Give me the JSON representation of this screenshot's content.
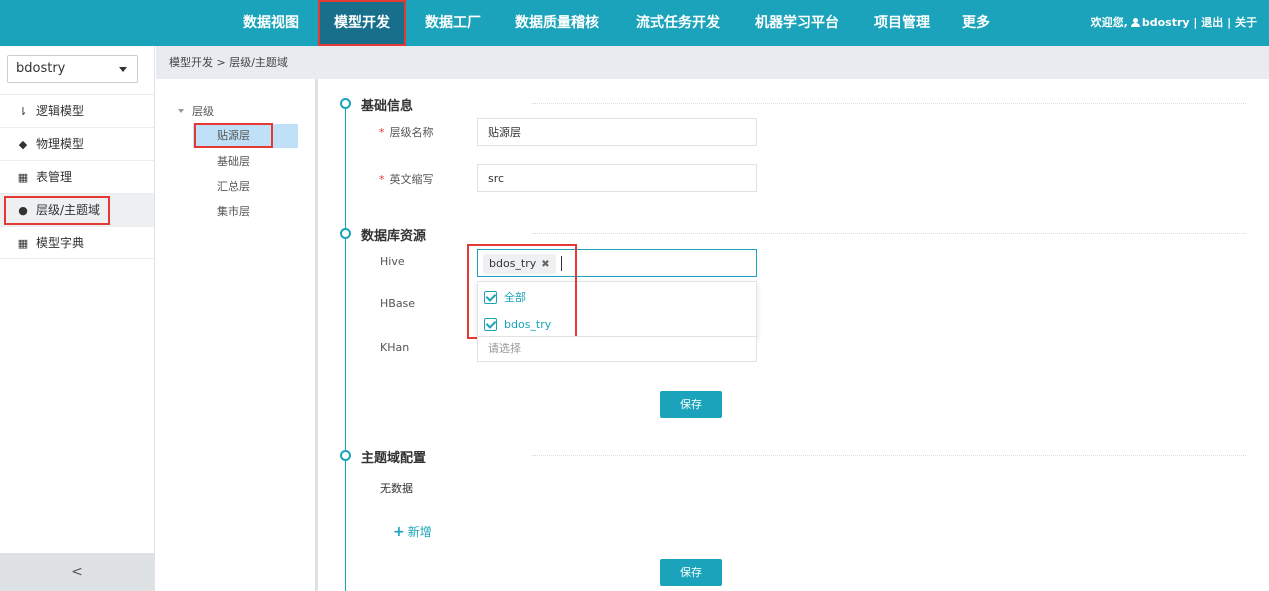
{
  "nav": {
    "items": [
      "数据视图",
      "模型开发",
      "数据工厂",
      "数据质量稽核",
      "流式任务开发",
      "机器学习平台",
      "项目管理",
      "更多"
    ],
    "active": "模型开发",
    "welcome": "欢迎您,",
    "username": "bdostry",
    "logout": "退出",
    "about": "关于",
    "separator": "|"
  },
  "sidebar": {
    "project_select": "bdostry",
    "items": [
      {
        "icon": "sort-icon",
        "glyph": "⇂",
        "label": "逻辑模型"
      },
      {
        "icon": "cube-icon",
        "glyph": "◆",
        "label": "物理模型"
      },
      {
        "icon": "grid-icon",
        "glyph": "▦",
        "label": "表管理"
      },
      {
        "icon": "layers-icon",
        "glyph": "●",
        "label": "层级/主题域",
        "active": true
      },
      {
        "icon": "grid-icon",
        "glyph": "▦",
        "label": "模型字典"
      }
    ],
    "collapse_glyph": "<"
  },
  "breadcrumb": {
    "parent": "模型开发",
    "separator": ">",
    "current": "层级/主题域"
  },
  "tree": {
    "root": "层级",
    "nodes": [
      "贴源层",
      "基础层",
      "汇总层",
      "集市层"
    ],
    "selected": "贴源层"
  },
  "basic_info": {
    "title": "基础信息",
    "name_label": "层级名称",
    "name_value": "贴源层",
    "abbr_label": "英文缩写",
    "abbr_value": "src",
    "required_mark": "*"
  },
  "db_resources": {
    "title": "数据库资源",
    "hive_label": "Hive",
    "hive_tag": "bdos_try",
    "hive_tag_remove": "✖",
    "hbase_label": "HBase",
    "khan_label": "KHan",
    "khan_placeholder": "请选择",
    "dropdown_options": [
      "全部",
      "bdos_try"
    ],
    "save": "保存"
  },
  "topic_config": {
    "title": "主题域配置",
    "empty": "无数据",
    "add": "新增",
    "add_glyph": "+",
    "save": "保存"
  },
  "colors": {
    "primary": "#1aa3ba",
    "nav_active": "#176f8c",
    "highlight": "#e53935",
    "tree_selected": "#bfe0f7"
  }
}
